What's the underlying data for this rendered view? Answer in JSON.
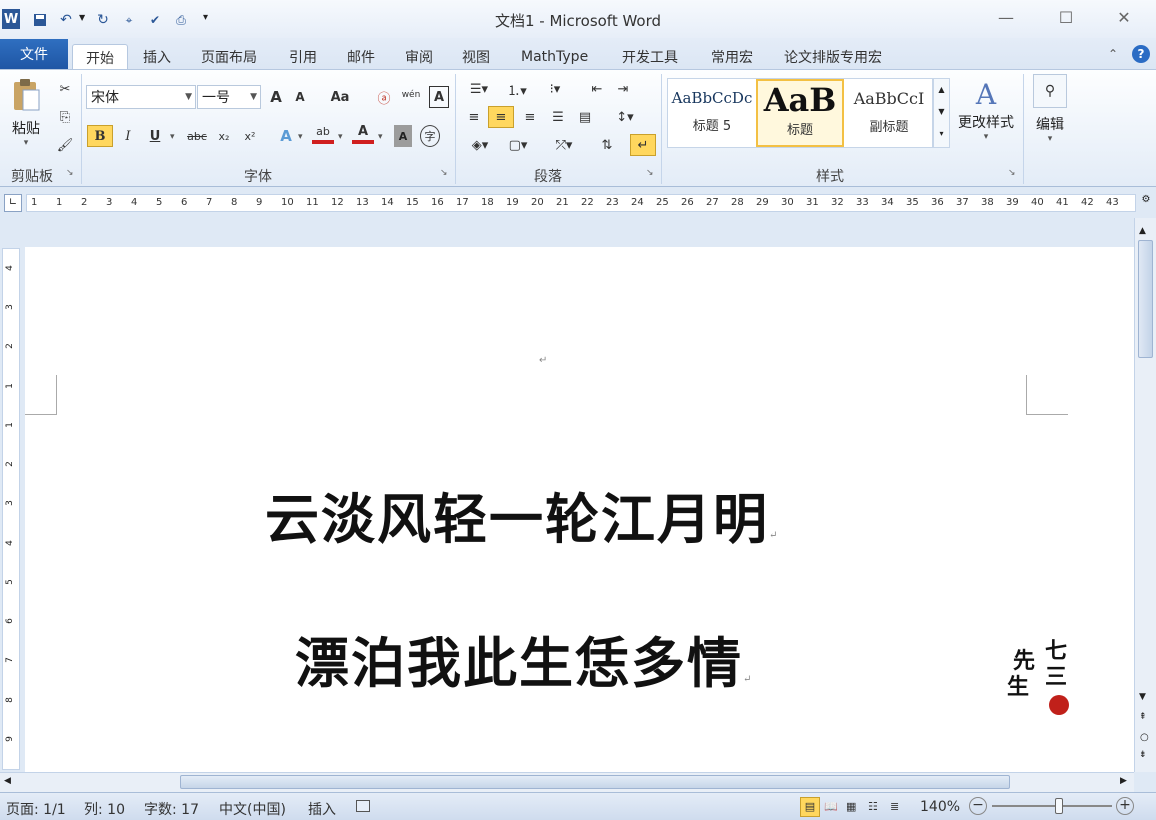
{
  "window": {
    "title": "文档1 - Microsoft Word",
    "app_icon": "W",
    "controls": {
      "minimize": "—",
      "maximize": "☐",
      "close": "✕"
    }
  },
  "qat": {
    "icons": [
      "save-icon",
      "undo-icon",
      "redo-icon",
      "format-painter-icon",
      "spell-icon",
      "print-icon",
      "customize-icon"
    ]
  },
  "tabs": {
    "file": "文件",
    "items": [
      "开始",
      "插入",
      "页面布局",
      "引用",
      "邮件",
      "审阅",
      "视图",
      "MathType",
      "开发工具",
      "常用宏",
      "论文排版专用宏"
    ],
    "active": "开始"
  },
  "ribbon": {
    "clipboard": {
      "paste": "粘贴",
      "label": "剪贴板"
    },
    "font": {
      "name": "宋体",
      "size": "一号",
      "label": "字体",
      "buttons": {
        "grow": "A",
        "shrink": "A",
        "case": "Aa",
        "bold": "B",
        "italic": "I",
        "underline": "U",
        "strike": "abc",
        "sub": "x₂",
        "sup": "x²",
        "text_effect": "A",
        "highlight": "ab",
        "font_color": "A",
        "char_shade": "A",
        "enclose": "字",
        "phonetic": "wén",
        "border": "A"
      }
    },
    "paragraph": {
      "label": "段落"
    },
    "styles": {
      "label": "样式",
      "items": [
        {
          "preview": "AaBbCcDc",
          "name": "标题 5"
        },
        {
          "preview": "AaB",
          "name": "标题"
        },
        {
          "preview": "AaBbCcI",
          "name": "副标题"
        }
      ],
      "change": "更改样式",
      "edit": "编辑"
    }
  },
  "ruler": {
    "numbers": [
      "1",
      "1",
      "2",
      "3",
      "4",
      "5",
      "6",
      "7",
      "8",
      "9",
      "10",
      "11",
      "12",
      "13",
      "14",
      "15",
      "16",
      "17",
      "18",
      "19",
      "20",
      "21",
      "22",
      "23",
      "24",
      "25",
      "26",
      "27",
      "28",
      "29",
      "30",
      "31",
      "32",
      "33",
      "34",
      "35",
      "36",
      "37",
      "38",
      "39",
      "40",
      "41",
      "42",
      "43"
    ]
  },
  "vruler": {
    "numbers": [
      "4",
      "3",
      "2",
      "1",
      "1",
      "2",
      "3",
      "4",
      "5",
      "6",
      "7",
      "8",
      "9"
    ]
  },
  "document": {
    "lines": [
      "云淡风轻一轮江月明",
      "漂泊我此生恁多情"
    ],
    "paragraph_mark": "↵",
    "seal": {
      "line1": "七",
      "line2": "三",
      "line3": "先",
      "line4": "生"
    }
  },
  "status": {
    "page": "页面: 1/1",
    "column": "列: 10",
    "words": "字数: 17",
    "language": "中文(中国)",
    "mode": "插入",
    "zoom": "140%",
    "zoom_level": 0.56
  },
  "colors": {
    "file_tab": "#2a64b6",
    "accent": "#2b5797",
    "highlight_yellow": "#ffd75e",
    "seal_red": "#c0201a"
  }
}
